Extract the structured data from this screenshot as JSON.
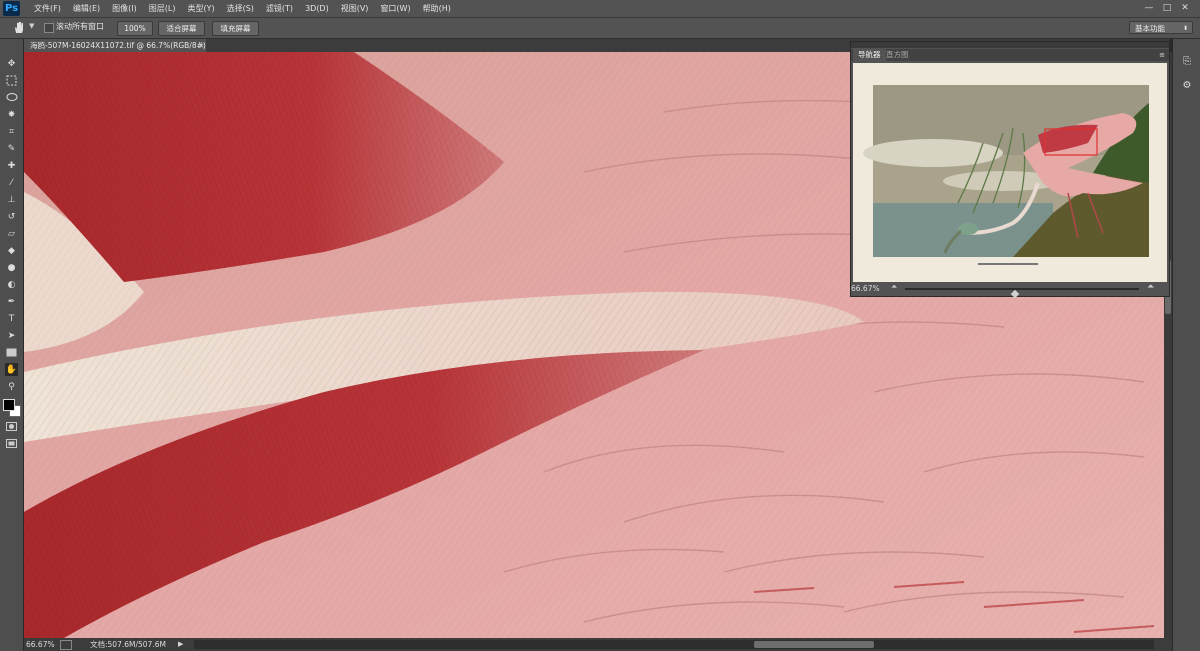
{
  "app": {
    "logo": "Ps"
  },
  "menu": [
    "文件(F)",
    "编辑(E)",
    "图像(I)",
    "图层(L)",
    "类型(Y)",
    "选择(S)",
    "滤镜(T)",
    "3D(D)",
    "视图(V)",
    "窗口(W)",
    "帮助(H)"
  ],
  "window_controls": [
    "—",
    "□",
    "✕"
  ],
  "options": {
    "scroll_all_label": "滚动所有窗口",
    "zoom100": "100%",
    "fit_screen": "适合屏幕",
    "fill_screen": "填充屏幕",
    "workspace": "基本功能"
  },
  "document": {
    "tab_title": "海鸥-507M-16024X11072.tif @ 66.7%(RGB/8#)",
    "close": "×"
  },
  "status": {
    "zoom": "66.67%",
    "doc_info": "文档:507.6M/507.6M"
  },
  "navigator": {
    "tab_active": "导航器",
    "tab_inactive": "直方图",
    "zoom": "66.67%",
    "slider_fraction": 0.47
  },
  "colors": {
    "accent": "#31a8ff",
    "view_box": "#e03030",
    "feather_pink": "#e8a6a6",
    "feather_red": "#b0282c"
  }
}
